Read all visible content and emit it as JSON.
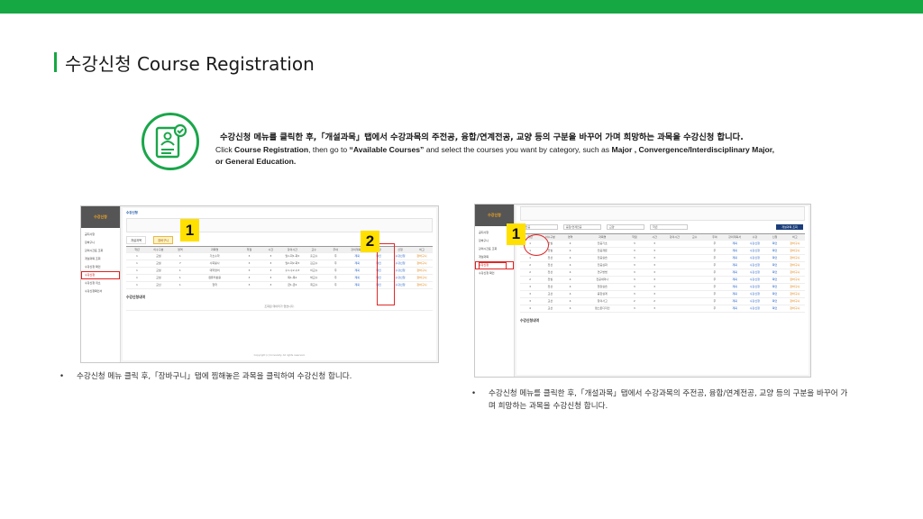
{
  "colors": {
    "accent": "#15a843",
    "marker": "#ffe000",
    "highlight": "#e02828"
  },
  "title": "수강신청 Course Registration",
  "intro": {
    "ko": "수강신청 메뉴를 클릭한 후,「개설과목」탭에서 수강과목의 주전공, 융합/연계전공, 교양 등의 구분을 바꾸어 가며 희망하는 과목을 수강신청 합니다.",
    "en_prefix": "Click ",
    "en_bold1": "Course Registration",
    "en_mid": ", then go to ",
    "en_bold2": "“Available Courses”",
    "en_mid2": " and select the courses you want by category, such as ",
    "en_bold3": "Major , Convergence/Interdisciplinary Major,",
    "en_end": " ",
    "en_bold4": "or General Education."
  },
  "icon": "document-user-check-icon",
  "left_shot": {
    "logo": "수강신청",
    "menu": [
      "공지사항",
      "장바구니",
      "강의시간표 조회",
      "개설과목 조회",
      "수강신청 확인",
      "수강신청",
      "수강신청 취소",
      "수강신청확인서"
    ],
    "menu_active_index": 5,
    "header": "수강신청",
    "tabs": [
      "개설과목",
      "장바구니"
    ],
    "table_headers": [
      "학년",
      "이수구분",
      "영역",
      "과목명",
      "학점",
      "시간",
      "강의시간",
      "교수",
      "주야",
      "강의계획서",
      "수강",
      "신청",
      "비고"
    ],
    "rows": [
      [
        "1",
        "교필",
        "1",
        "기초수학",
        "3",
        "3",
        "월1,화1,화2",
        "홍교수",
        "주",
        "계획",
        "확인",
        "수강신청",
        "장바구니"
      ],
      [
        "1",
        "교필",
        "7",
        "사회봉사",
        "3",
        "3",
        "월2,화2,화3",
        "김교수",
        "주",
        "계획",
        "확인",
        "수강신청",
        "장바구니"
      ],
      [
        "1",
        "교필",
        "1",
        "대학영어",
        "3",
        "3",
        "수1,수2,수3",
        "이교수",
        "주",
        "계획",
        "확인",
        "수강신청",
        "장바구니"
      ],
      [
        "1",
        "교필",
        "1",
        "컴퓨터활용",
        "3",
        "3",
        "목1,목2",
        "박교수",
        "주",
        "계획",
        "확인",
        "수강신청",
        "장바구니"
      ],
      [
        "1",
        "교선",
        "1",
        "철학",
        "3",
        "3",
        "금1,금2",
        "최교수",
        "주",
        "계획",
        "확인",
        "수강신청",
        "장바구니"
      ]
    ],
    "sub_title": "수강신청내역",
    "empty_message": "조회된 데이터가 없습니다.",
    "footer": "Copyright (c) University. All rights reserved."
  },
  "right_shot": {
    "logo": "수강신청",
    "menu": [
      "공지사항",
      "장바구니",
      "강의시간표 조회",
      "개설과목",
      "수강신청",
      "수강신청 확인"
    ],
    "menu_active_index": 4,
    "filters": [
      "주전공",
      "융합/연계전공",
      "교양",
      "학년"
    ],
    "search_button": "개설과목 조회",
    "table_headers": [
      "학년",
      "이수구분",
      "영역",
      "과목명",
      "학점",
      "시간",
      "강의시간",
      "교수",
      "주야",
      "강의계획서",
      "수강",
      "신청",
      "비고"
    ],
    "rows": [
      [
        "1",
        "전필",
        "4",
        "전공기초",
        "3",
        "3",
        "",
        "",
        "주",
        "계획",
        "수강신청",
        "확인",
        "장바구니"
      ],
      [
        "1",
        "전필",
        "4",
        "전공개론",
        "3",
        "3",
        "",
        "",
        "주",
        "계획",
        "수강신청",
        "확인",
        "장바구니"
      ],
      [
        "1",
        "전선",
        "4",
        "전공실습",
        "3",
        "3",
        "",
        "",
        "주",
        "계획",
        "수강신청",
        "확인",
        "장바구니"
      ],
      [
        "2",
        "전선",
        "4",
        "전공심화",
        "3",
        "3",
        "",
        "",
        "주",
        "계획",
        "수강신청",
        "확인",
        "장바구니"
      ],
      [
        "2",
        "전선",
        "4",
        "연구방법",
        "3",
        "3",
        "",
        "",
        "주",
        "계획",
        "수강신청",
        "확인",
        "장바구니"
      ],
      [
        "2",
        "전필",
        "4",
        "전공세미나",
        "3",
        "3",
        "",
        "",
        "주",
        "계획",
        "수강신청",
        "확인",
        "장바구니"
      ],
      [
        "3",
        "전선",
        "4",
        "현장실습",
        "3",
        "3",
        "",
        "",
        "주",
        "계획",
        "수강신청",
        "확인",
        "장바구니"
      ],
      [
        "3",
        "교선",
        "4",
        "융합설계",
        "3",
        "3",
        "",
        "",
        "주",
        "계획",
        "수강신청",
        "확인",
        "장바구니"
      ],
      [
        "3",
        "교선",
        "4",
        "창의사고",
        "2",
        "2",
        "",
        "",
        "주",
        "계획",
        "수강신청",
        "확인",
        "장바구니"
      ],
      [
        "4",
        "교선",
        "4",
        "캡스톤디자인",
        "3",
        "3",
        "",
        "",
        "주",
        "계획",
        "수강신청",
        "확인",
        "장바구니"
      ]
    ],
    "sub_title": "수강신청내역"
  },
  "markers": {
    "m1": "1",
    "m2": "2",
    "m3": "1"
  },
  "captions": {
    "bullet": "•",
    "left": "수강신청 메뉴 클릭 후,「장바구니」탭에 찜해놓은 과목을 클릭하여 수강신청 합니다.",
    "right": "수강신청 메뉴를 클릭한 후,「개설과목」탭에서 수강과목의 주전공, 융합/연계전공, 교양 등의 구분을 바꾸어 가며 희망하는 과목을 수강신청 합니다."
  }
}
